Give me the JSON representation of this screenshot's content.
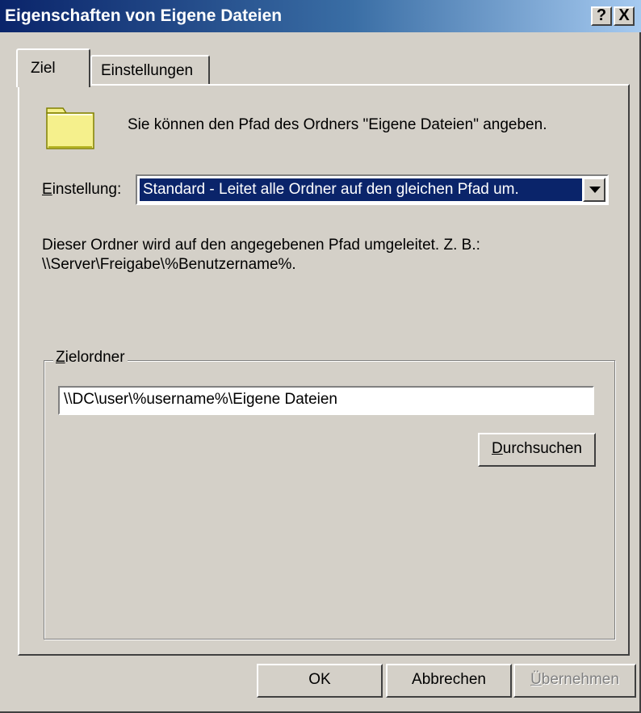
{
  "window": {
    "title": "Eigenschaften von Eigene Dateien",
    "help_button": "?",
    "close_button": "X"
  },
  "tabs": [
    {
      "label": "Ziel",
      "active": true
    },
    {
      "label": "Einstellungen",
      "active": false
    }
  ],
  "content": {
    "intro": "Sie können den Pfad des Ordners \"Eigene Dateien\" angeben.",
    "setting_label_mnemonic": "E",
    "setting_label_rest": "instellung:",
    "setting_value": "Standard - Leitet alle Ordner auf den gleichen Pfad um.",
    "description_line1": "Dieser Ordner wird auf den angegebenen Pfad umgeleitet. Z. B.:",
    "description_line2": "\\\\Server\\Freigabe\\%Benutzername%.",
    "group_label_mnemonic": "Z",
    "group_label_rest": "ielordner",
    "target_path": "\\\\DC\\user\\%username%\\Eigene Dateien",
    "browse_mnemonic": "D",
    "browse_rest": "urchsuchen"
  },
  "footer": {
    "ok": "OK",
    "cancel": "Abbrechen",
    "apply_mnemonic": "Ü",
    "apply_rest": "bernehmen"
  },
  "colors": {
    "face": "#d4d0c8",
    "title_start": "#0a246a",
    "title_end": "#a6caf0",
    "selection": "#0a246a",
    "folder": "#f5f08c"
  },
  "icons": [
    "folder-icon",
    "help-icon",
    "close-icon",
    "dropdown-arrow-icon"
  ]
}
